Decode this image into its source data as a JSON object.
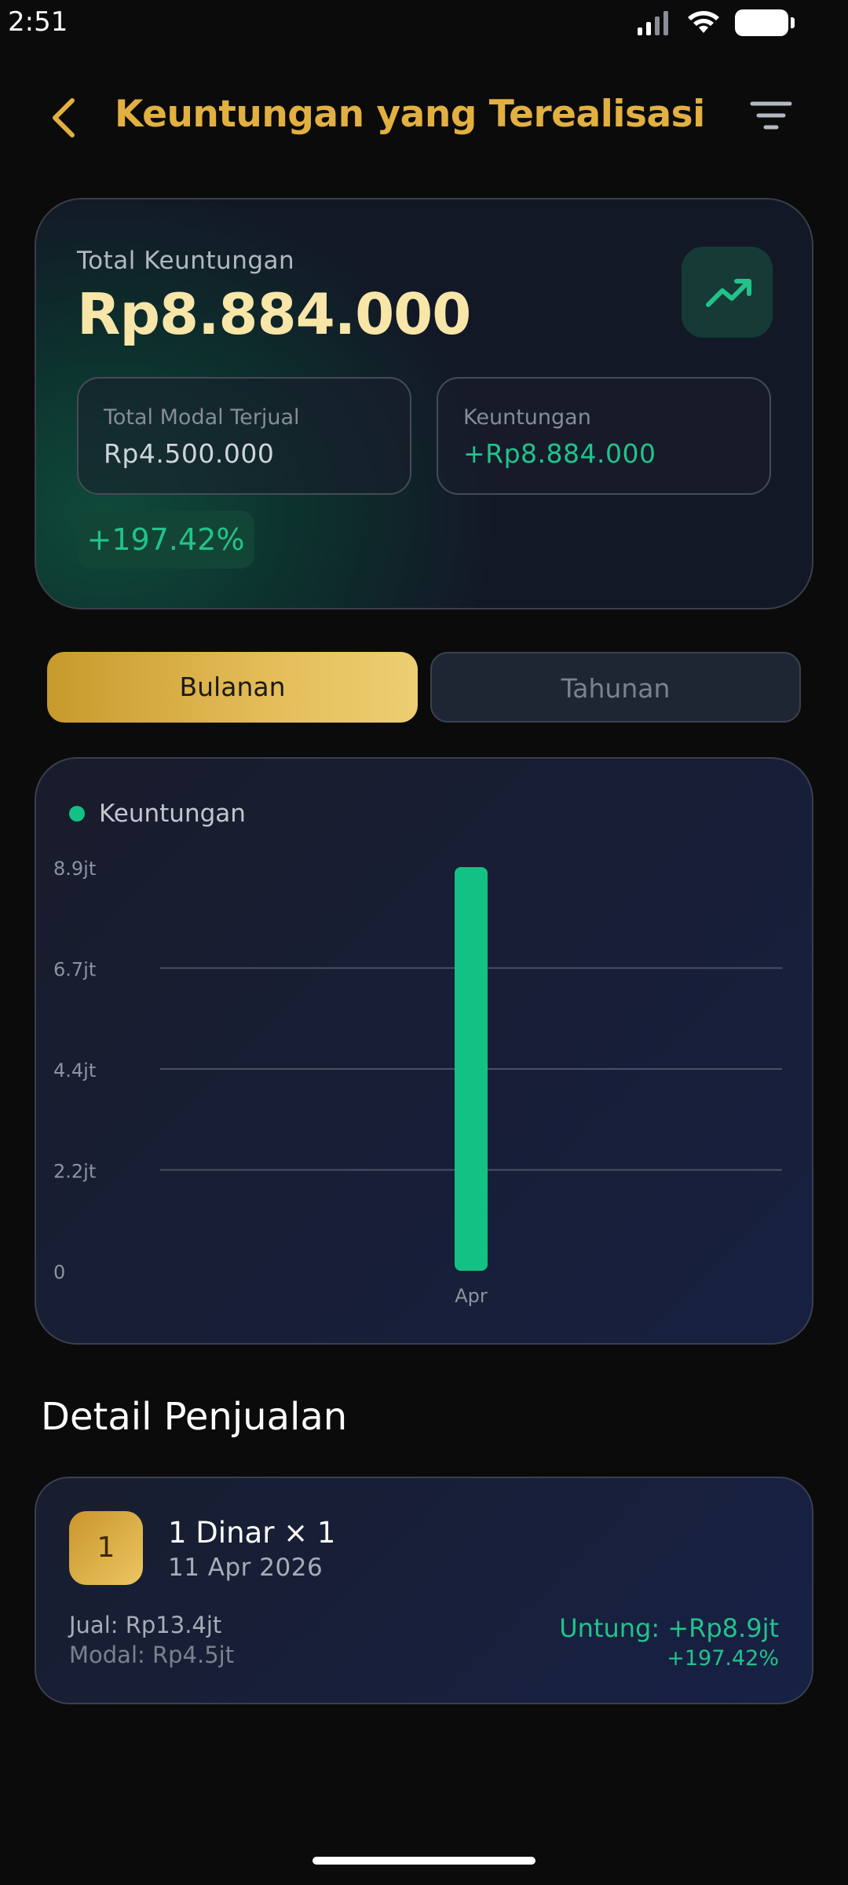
{
  "status_bar": {
    "time": "2:51"
  },
  "header": {
    "title": "Keuntungan yang Terealisasi"
  },
  "summary": {
    "total_label": "Total Keuntungan",
    "total_value": "Rp8.884.000",
    "modal_label": "Total Modal Terjual",
    "modal_value": "Rp4.500.000",
    "profit_label": "Keuntungan",
    "profit_value": "+Rp8.884.000",
    "percent": "+197.42%"
  },
  "period_toggle": {
    "monthly": "Bulanan",
    "yearly": "Tahunan",
    "selected": "Bulanan"
  },
  "chart_data": {
    "type": "bar",
    "categories": [
      "Apr"
    ],
    "series": [
      {
        "name": "Keuntungan",
        "values": [
          8884000
        ],
        "color": "#14c184"
      }
    ],
    "y_ticks": [
      "0",
      "2.2jt",
      "4.4jt",
      "6.7jt",
      "8.9jt"
    ],
    "y_tick_values": [
      0,
      2221000,
      4442000,
      6663000,
      8884000
    ],
    "ylim": [
      0,
      8884000
    ],
    "grid": true,
    "legend": "top-left"
  },
  "details": {
    "title": "Detail Penjualan",
    "items": [
      {
        "rank": "1",
        "name": "1 Dinar × 1",
        "date": "11 Apr 2026",
        "jual": "Jual: Rp13.4jt",
        "modal": "Modal: Rp4.5jt",
        "profit": "Untung: +Rp8.9jt",
        "percent": "+197.42%"
      }
    ]
  },
  "colors": {
    "accent_gold": "#e2b041",
    "positive_green": "#22c38b",
    "background": "#0b0b0c"
  }
}
